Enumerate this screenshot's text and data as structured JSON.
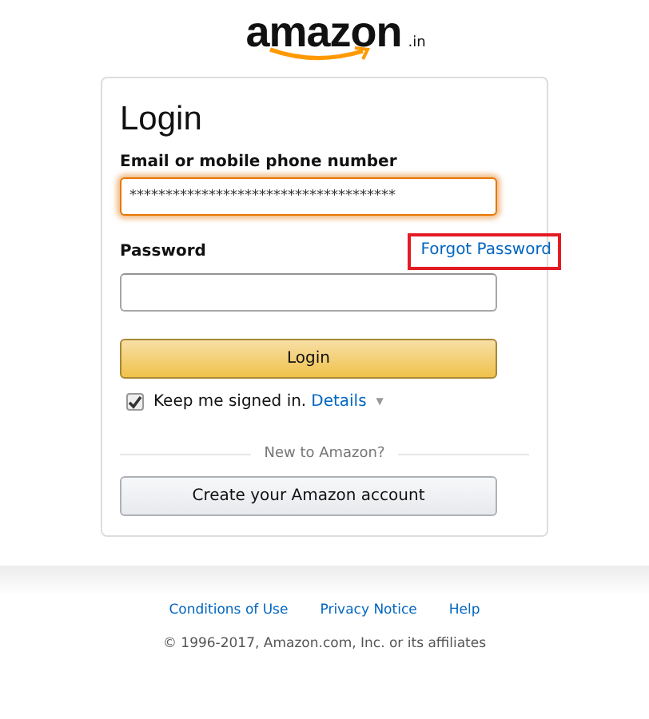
{
  "logo": {
    "wordmark": "amazon",
    "suffix": ".in"
  },
  "form": {
    "title": "Login",
    "email": {
      "label": "Email or mobile phone number",
      "value": "*************************************",
      "focused": true
    },
    "password": {
      "label": "Password",
      "forgot_link": {
        "label": "Forgot Password",
        "highlighted": true
      }
    },
    "submit": "Login",
    "keep_signed_in": {
      "label": "Keep me signed in.",
      "checked": true,
      "details": "Details",
      "caret": "▼"
    },
    "divider_text": "New to Amazon?",
    "create_account": "Create your Amazon account"
  },
  "footer": {
    "links": [
      "Conditions of Use",
      "Privacy Notice",
      "Help"
    ],
    "copyright": "© 1996-2017, Amazon.com, Inc. or its affiliates"
  }
}
